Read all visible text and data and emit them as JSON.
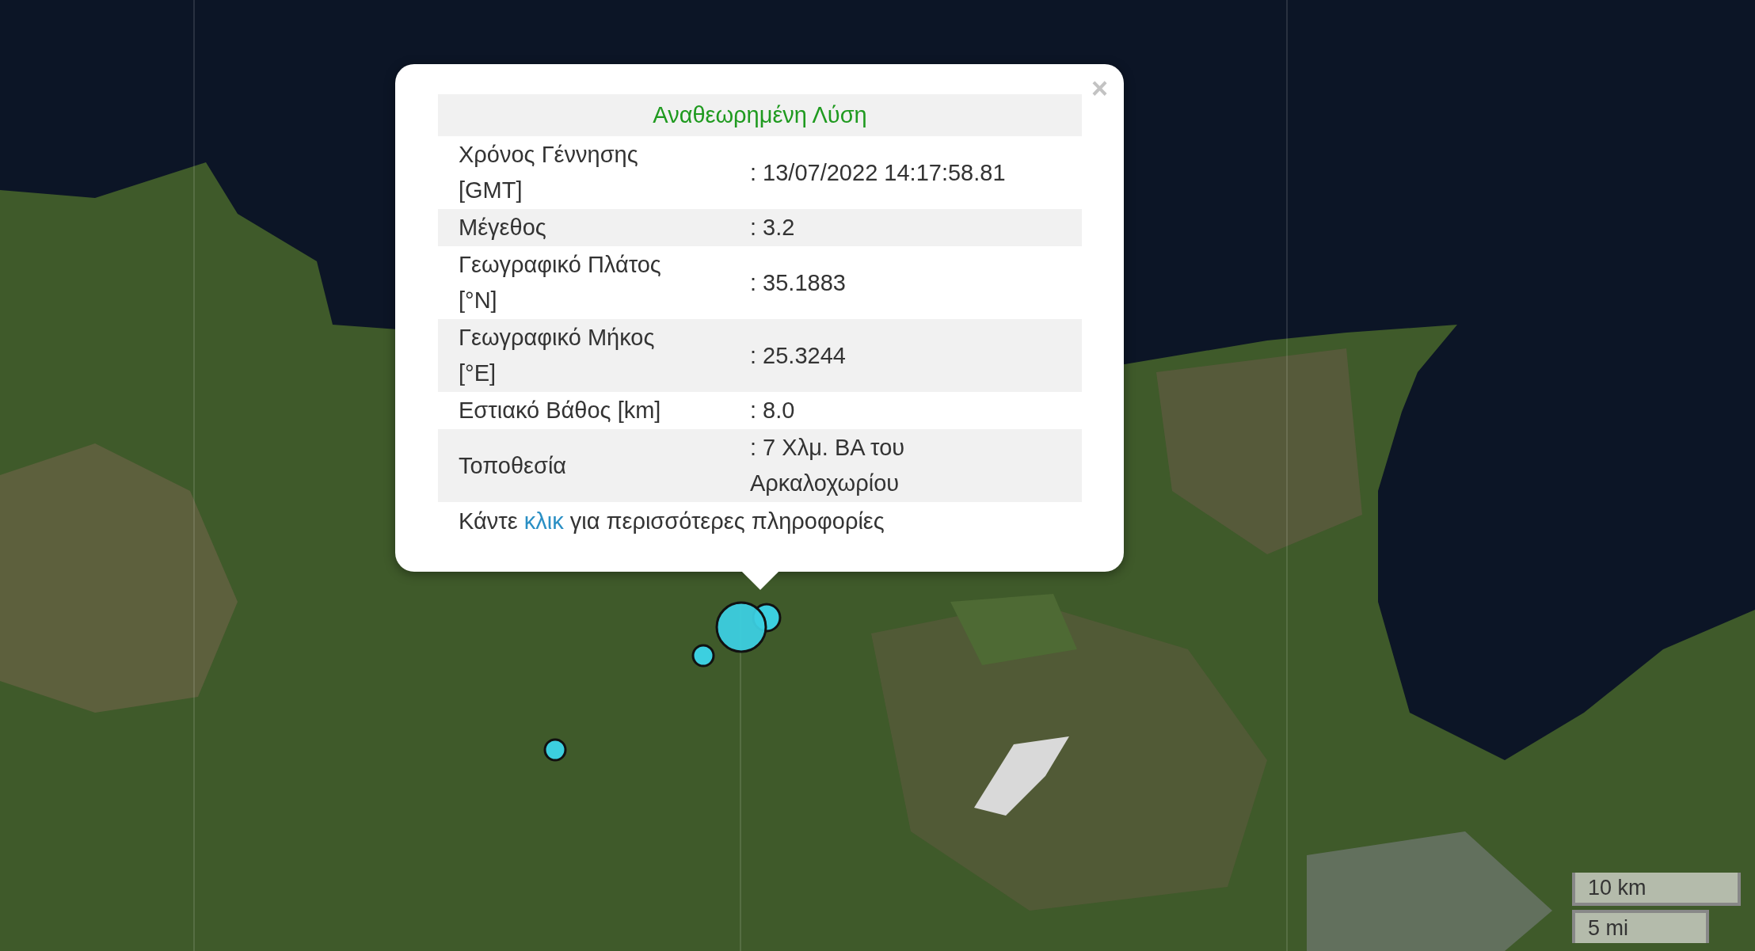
{
  "popup": {
    "title": "Αναθεωρημένη Λύση",
    "close": "×",
    "rows": [
      {
        "label": "Χρόνος Γέννησης [GMT]",
        "value": ": 13/07/2022 14:17:58.81"
      },
      {
        "label": "Μέγεθος",
        "value": ": 3.2"
      },
      {
        "label": "Γεωγραφικό Πλάτος [°N]",
        "value": ": 35.1883"
      },
      {
        "label": "Γεωγραφικό Μήκος [°E]",
        "value": ": 25.3244"
      },
      {
        "label": "Εστιακό Βάθος [km]",
        "value": ": 8.0"
      },
      {
        "label": "Τοποθεσία",
        "value": ": 7 Χλμ. ΒΑ του Αρκαλοχωρίου"
      }
    ],
    "footer": {
      "before": "Κάντε",
      "link": "κλικ",
      "after": "για περισσότερες πληροφορίες"
    }
  },
  "scale": {
    "metric": "10 km",
    "imperial": "5 mi"
  }
}
